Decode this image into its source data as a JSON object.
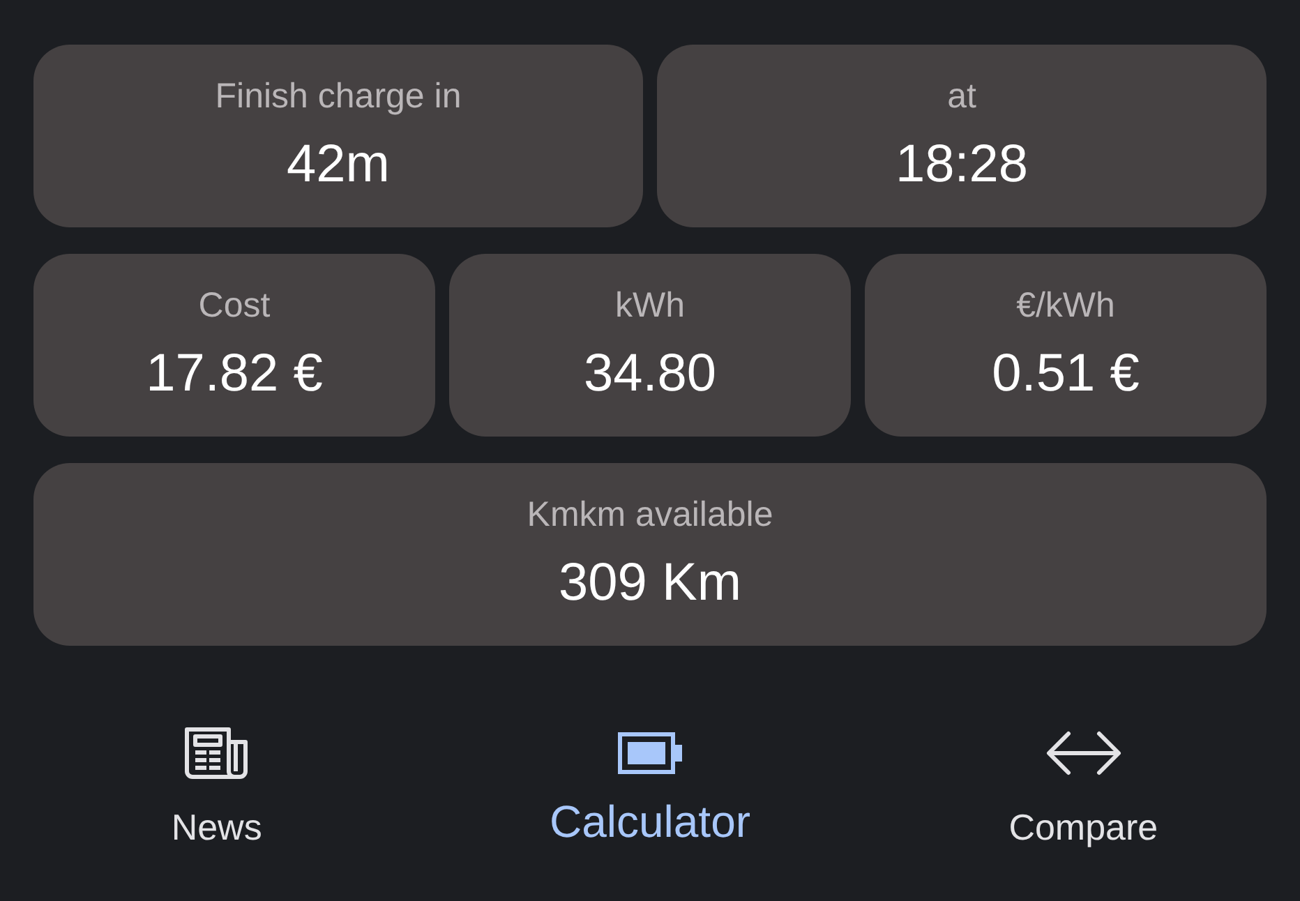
{
  "rows": [
    {
      "cards": [
        {
          "label": "Finish charge in",
          "value": "42m"
        },
        {
          "label": "at",
          "value": "18:28"
        }
      ]
    },
    {
      "cards": [
        {
          "label": "Cost",
          "value": "17.82 €"
        },
        {
          "label": "kWh",
          "value": "34.80"
        },
        {
          "label": "€/kWh",
          "value": "0.51 €"
        }
      ]
    },
    {
      "cards": [
        {
          "label": "Kmkm available",
          "value": "309 Km"
        }
      ]
    }
  ],
  "nav": [
    {
      "label": "News",
      "selected": false
    },
    {
      "label": "Calculator",
      "selected": true
    },
    {
      "label": "Compare",
      "selected": false
    }
  ]
}
